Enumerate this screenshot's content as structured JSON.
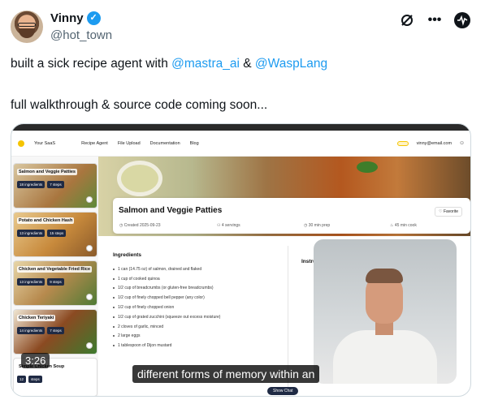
{
  "tweet": {
    "display_name": "Vinny",
    "handle": "@hot_town",
    "verified_icon": "verified-badge-icon",
    "header_icons": [
      "no-subscribe-icon",
      "more-icon",
      "grok-icon"
    ],
    "line1": {
      "prefix": "built a sick recipe agent with ",
      "mention1": "@mastra_ai",
      "middle": " & ",
      "mention2": "@WaspLang"
    },
    "line2": "full walkthrough & source code coming soon...",
    "colors": {
      "mention": "#1d9bf0",
      "text": "#0f1419",
      "muted": "#536471"
    }
  },
  "video": {
    "timestamp": "3:26",
    "subtitle": "different forms of memory within an",
    "app": {
      "brand": "Your SaaS",
      "nav": [
        "Recipe Agent",
        "File Upload",
        "Documentation",
        "Blog"
      ],
      "user_email": "vinny@email.com",
      "sidebar_cards": [
        {
          "title": "Salmon and Veggie Patties",
          "ingredients": "18 ingredients",
          "steps": "7 steps"
        },
        {
          "title": "Potato and Chicken Hash",
          "ingredients": "13 ingredients",
          "steps": "15 steps"
        },
        {
          "title": "Chicken and Vegetable Fried Rice",
          "ingredients": "13 ingredients",
          "steps": "9 steps"
        },
        {
          "title": "Chicken Teriyaki",
          "ingredients": "14 ingredients",
          "steps": "7 steps"
        },
        {
          "title": "Simple Chicken Soup",
          "ingredients": "12",
          "steps": "steps"
        }
      ],
      "recipe": {
        "title": "Salmon and Veggie Patties",
        "favorite": "Favorite",
        "created": "Created 2025-09-23",
        "servings": "4 servings",
        "prep": "30 min prep",
        "cook": "45 min cook"
      },
      "ingredients_title": "Ingredients",
      "ingredients": [
        "1 can (14.75 oz) of salmon, drained and flaked",
        "1 cup of cooked quinoa",
        "1/2 cup of breadcrumbs (or gluten-free breadcrumbs)",
        "1/2 cup of finely chopped bell pepper (any color)",
        "1/2 cup of finely chopped onion",
        "1/2 cup of grated zucchini (squeeze out excess moisture)",
        "2 cloves of garlic, minced",
        "2 large eggs",
        "1 tablespoon of Dijon mustard"
      ],
      "instructions_title": "Instru",
      "show_chat": "Show Chat"
    }
  }
}
